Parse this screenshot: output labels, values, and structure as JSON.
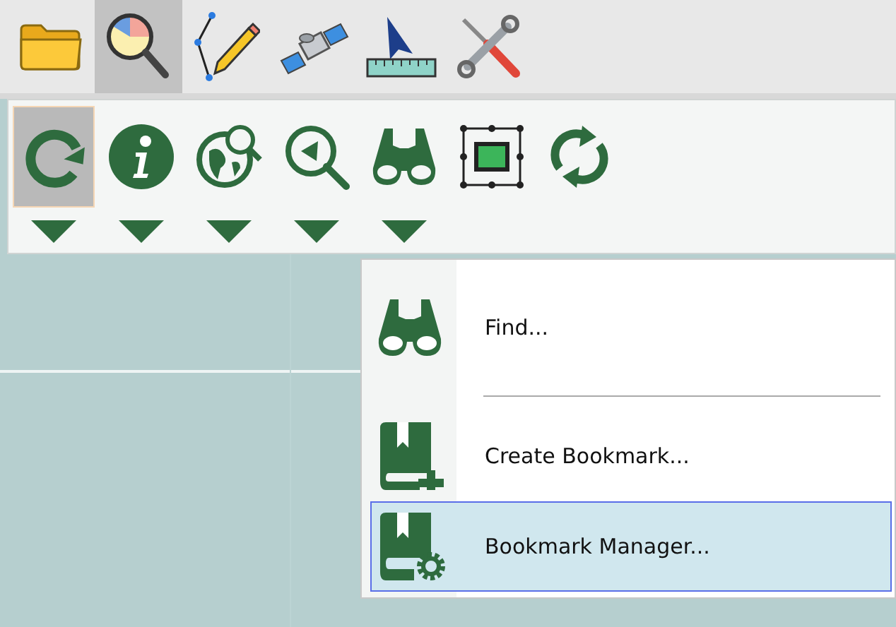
{
  "ribbon_tabs": [
    {
      "kind": "folder",
      "selected": false
    },
    {
      "kind": "analysis",
      "selected": true
    },
    {
      "kind": "edit",
      "selected": false
    },
    {
      "kind": "satellite",
      "selected": false
    },
    {
      "kind": "measure",
      "selected": false
    },
    {
      "kind": "tools",
      "selected": false
    }
  ],
  "tools": [
    {
      "kind": "refresh",
      "selected": true,
      "dropdown": true
    },
    {
      "kind": "info",
      "selected": false,
      "dropdown": true
    },
    {
      "kind": "globe-search",
      "selected": false,
      "dropdown": true
    },
    {
      "kind": "zoom-back",
      "selected": false,
      "dropdown": true
    },
    {
      "kind": "binoculars",
      "selected": false,
      "dropdown": true
    },
    {
      "kind": "select-frame",
      "selected": false,
      "dropdown": false
    },
    {
      "kind": "sync",
      "selected": false,
      "dropdown": false
    }
  ],
  "menu": {
    "items": [
      {
        "kind": "find",
        "label": "Find...",
        "selected": false
      },
      {
        "kind": "separator"
      },
      {
        "kind": "create-bookmark",
        "label": "Create Bookmark...",
        "selected": false
      },
      {
        "kind": "manage-bookmarks",
        "label": "Bookmark Manager...",
        "selected": true
      }
    ]
  }
}
